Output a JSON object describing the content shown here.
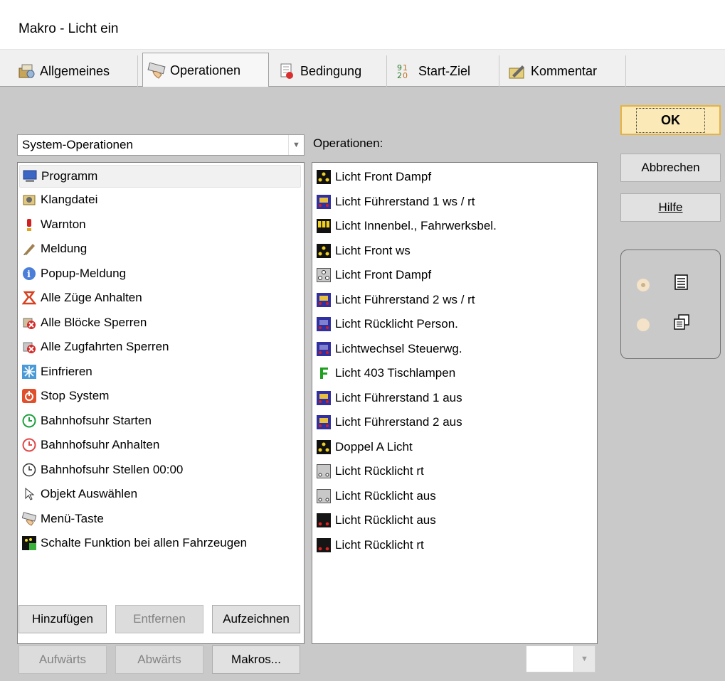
{
  "window": {
    "title": "Makro - Licht ein"
  },
  "tabs": [
    {
      "label": "Allgemeines",
      "icon": "general-settings-icon",
      "active": false
    },
    {
      "label": "Operationen",
      "icon": "keyboard-hand-icon",
      "active": true
    },
    {
      "label": "Bedingung",
      "icon": "condition-icon",
      "active": false
    },
    {
      "label": "Start-Ziel",
      "icon": "start-goal-icon",
      "active": false
    },
    {
      "label": "Kommentar",
      "icon": "comment-icon",
      "active": false
    }
  ],
  "category_select": {
    "value": "System-Operationen"
  },
  "operations_label": "Operationen:",
  "system_operations": [
    {
      "label": "Programm",
      "icon": "monitor-icon",
      "selected": true
    },
    {
      "label": "Klangdatei",
      "icon": "speaker-icon"
    },
    {
      "label": "Warnton",
      "icon": "exclamation-icon"
    },
    {
      "label": "Meldung",
      "icon": "pencil-icon"
    },
    {
      "label": "Popup-Meldung",
      "icon": "info-icon"
    },
    {
      "label": "Alle Züge Anhalten",
      "icon": "stop-hand-icon"
    },
    {
      "label": "Alle Blöcke Sperren",
      "icon": "block-lock-icon"
    },
    {
      "label": "Alle Zugfahrten Sperren",
      "icon": "route-lock-icon"
    },
    {
      "label": "Einfrieren",
      "icon": "snowflake-icon"
    },
    {
      "label": "Stop System",
      "icon": "power-icon"
    },
    {
      "label": "Bahnhofsuhr Starten",
      "icon": "clock-green-icon"
    },
    {
      "label": "Bahnhofsuhr Anhalten",
      "icon": "clock-red-icon"
    },
    {
      "label": "Bahnhofsuhr Stellen 00:00",
      "icon": "clock-outline-icon"
    },
    {
      "label": "Objekt Auswählen",
      "icon": "cursor-icon"
    },
    {
      "label": "Menü-Taste",
      "icon": "keyboard-hand-icon"
    },
    {
      "label": "Schalte Funktion bei allen Fahrzeugen",
      "icon": "function-all-icon"
    }
  ],
  "operations": [
    {
      "label": "Licht Front Dampf",
      "icon": "lights-yellow-triangle-icon"
    },
    {
      "label": "Licht Führerstand 1 ws / rt",
      "icon": "cab-light-icon"
    },
    {
      "label": "Licht Innenbel., Fahrwerksbel.",
      "icon": "interior-light-icon"
    },
    {
      "label": "Licht Front ws",
      "icon": "lights-yellow-triangle-icon"
    },
    {
      "label": "Licht Front Dampf",
      "icon": "lights-grey-triangle-icon"
    },
    {
      "label": "Licht Führerstand 2 ws / rt",
      "icon": "cab-light-icon"
    },
    {
      "label": "Licht Rücklicht Person.",
      "icon": "cab-light-icon"
    },
    {
      "label": "Lichtwechsel Steuerwg.",
      "icon": "cab-light-icon"
    },
    {
      "label": "Licht 403 Tischlampen",
      "icon": "letter-f-icon"
    },
    {
      "label": "Licht Führerstand 1 aus",
      "icon": "cab-light-icon"
    },
    {
      "label": "Licht Führerstand 2 aus",
      "icon": "cab-light-icon"
    },
    {
      "label": "Doppel A Licht",
      "icon": "lights-yellow-triangle-icon"
    },
    {
      "label": "Licht Rücklicht rt",
      "icon": "tail-light-grey-icon"
    },
    {
      "label": "Licht Rücklicht aus",
      "icon": "tail-light-grey-icon"
    },
    {
      "label": "Licht Rücklicht aus",
      "icon": "tail-light-red-icon"
    },
    {
      "label": "Licht Rücklicht rt",
      "icon": "tail-light-red-icon"
    }
  ],
  "buttons": {
    "ok": "OK",
    "cancel": "Abbrechen",
    "help": "Hilfe",
    "add": "Hinzufügen",
    "remove": "Entfernen",
    "record": "Aufzeichnen",
    "up": "Aufwärts",
    "down": "Abwärts",
    "macros": "Makros..."
  },
  "view_mode": {
    "options": [
      "list-view-icon",
      "copy-view-icon"
    ],
    "selected": 0
  },
  "colors": {
    "client_bg": "#c9c9c9",
    "ok_bg": "#fbe9b7",
    "ok_border": "#e6b341"
  }
}
